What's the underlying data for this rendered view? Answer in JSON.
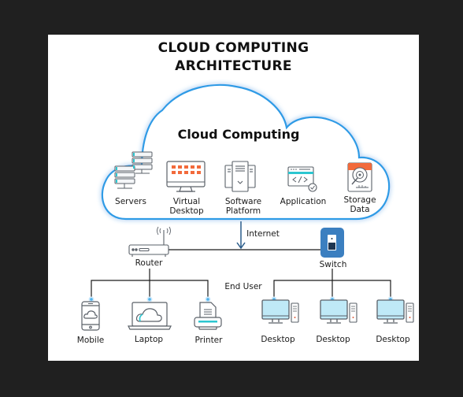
{
  "title": {
    "line1": "CLOUD COMPUTING",
    "line2": "ARCHITECTURE"
  },
  "cloud": {
    "title": "Cloud Computing",
    "services": [
      {
        "icon": "servers-icon",
        "label_lines": [
          "Servers"
        ]
      },
      {
        "icon": "virtual-desktop-icon",
        "label_lines": [
          "Virtual",
          "Desktop"
        ]
      },
      {
        "icon": "software-platform-icon",
        "label_lines": [
          "Software",
          "Platform"
        ]
      },
      {
        "icon": "application-icon",
        "label_lines": [
          "Application"
        ]
      },
      {
        "icon": "storage-data-icon",
        "label_lines": [
          "Storage",
          "Data"
        ]
      }
    ]
  },
  "network": {
    "internet_label": "Internet",
    "router_label": "Router",
    "switch_label": "Switch",
    "end_user_label": "End User"
  },
  "router_devices": [
    {
      "icon": "mobile-icon",
      "label": "Mobile"
    },
    {
      "icon": "laptop-icon",
      "label": "Laptop"
    },
    {
      "icon": "printer-icon",
      "label": "Printer"
    }
  ],
  "switch_devices": [
    {
      "icon": "desktop-icon",
      "label": "Desktop"
    },
    {
      "icon": "desktop-icon",
      "label": "Desktop"
    },
    {
      "icon": "desktop-icon",
      "label": "Desktop"
    }
  ],
  "colors": {
    "background": "#202020",
    "card": "#ffffff",
    "cloud_outline": "#2f9be6",
    "line": "#1a1a1a",
    "icon_stroke": "#5a6068",
    "accent_orange": "#f26a3b",
    "accent_cyan": "#2cc6d0",
    "screen_fill": "#bfe9f7",
    "switch_fill": "#3b7fc0",
    "node_dot": "#4fb3ec"
  }
}
